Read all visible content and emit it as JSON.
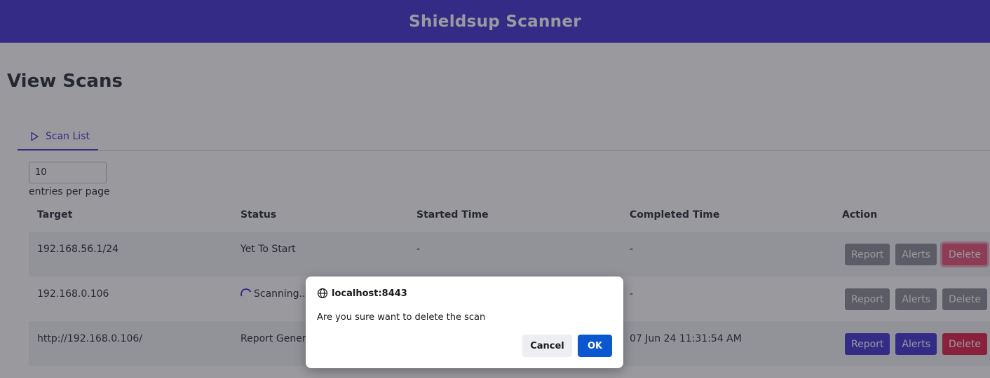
{
  "app": {
    "title": "Shieldsup Scanner"
  },
  "page": {
    "title": "View Scans"
  },
  "tabs": [
    {
      "label": "Scan List",
      "icon": "play-outline-icon"
    }
  ],
  "pagination": {
    "per_page_value": "10",
    "per_page_label": "entries per page"
  },
  "table": {
    "headers": [
      "Target",
      "Status",
      "Started Time",
      "Completed Time",
      "Action"
    ],
    "rows": [
      {
        "target": "192.168.56.1/24",
        "status": "Yet To Start",
        "started": "-",
        "completed": "-",
        "report": "Report",
        "alerts": "Alerts",
        "delete": "Delete"
      },
      {
        "target": "192.168.0.106",
        "status": "Scanning...",
        "started": "",
        "completed": "-",
        "report": "Report",
        "alerts": "Alerts",
        "delete": "Delete"
      },
      {
        "target": "http://192.168.0.106/",
        "status": "Report Gener",
        "started": "",
        "completed": "07 Jun 24 11:31:54 AM",
        "report": "Report",
        "alerts": "Alerts",
        "delete": "Delete"
      }
    ]
  },
  "dialog": {
    "origin": "localhost:8443",
    "message": "Are you sure want to delete the scan",
    "cancel_label": "Cancel",
    "ok_label": "OK"
  },
  "colors": {
    "brand": "#4536d6",
    "danger": "#e0234e",
    "disabled": "#8d8f99",
    "dialog_primary": "#0b57d0"
  }
}
